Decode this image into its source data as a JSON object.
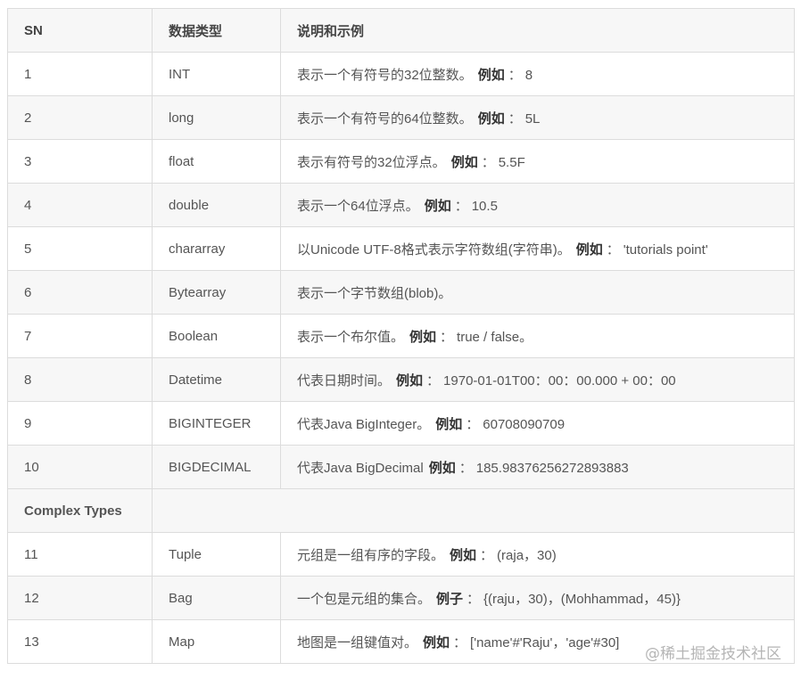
{
  "headers": [
    "SN",
    "数据类型",
    "说明和示例"
  ],
  "rows": [
    {
      "sn": "1",
      "type": "INT",
      "desc": "表示一个有符号的32位整数。",
      "ex_label": "例如",
      "ex_sep": "：",
      "ex_value": "8"
    },
    {
      "sn": "2",
      "type": "long",
      "desc": "表示一个有符号的64位整数。",
      "ex_label": "例如",
      "ex_sep": "：",
      "ex_value": "5L"
    },
    {
      "sn": "3",
      "type": "float",
      "desc": "表示有符号的32位浮点。",
      "ex_label": "例如",
      "ex_sep": "：",
      "ex_value": "5.5F"
    },
    {
      "sn": "4",
      "type": "double",
      "desc": "表示一个64位浮点。",
      "ex_label": "例如",
      "ex_sep": "：",
      "ex_value": "10.5"
    },
    {
      "sn": "5",
      "type": "chararray",
      "desc": "以Unicode UTF-8格式表示字符数组(字符串)。",
      "ex_label": "例如",
      "ex_sep": "：",
      "ex_value": "'tutorials point'"
    },
    {
      "sn": "6",
      "type": "Bytearray",
      "desc": "表示一个字节数组(blob)。",
      "ex_label": "",
      "ex_sep": "",
      "ex_value": ""
    },
    {
      "sn": "7",
      "type": "Boolean",
      "desc": "表示一个布尔值。",
      "ex_label": "例如",
      "ex_sep": "：",
      "ex_value": "true / false。"
    },
    {
      "sn": "8",
      "type": "Datetime",
      "desc": "代表日期时间。",
      "ex_label": "例如",
      "ex_sep": "：",
      "ex_value": "1970-01-01T00：00：00.000 + 00：00"
    },
    {
      "sn": "9",
      "type": "BIGINTEGER",
      "desc": "代表Java BigInteger。",
      "ex_label": "例如",
      "ex_sep": "：",
      "ex_value": "60708090709"
    },
    {
      "sn": "10",
      "type": "BIGDECIMAL",
      "desc": "代表Java BigDecimal",
      "ex_label": "例如",
      "ex_sep": "：",
      "ex_value": "185.98376256272893883"
    }
  ],
  "section_label": "Complex Types",
  "complex_rows": [
    {
      "sn": "11",
      "type": "Tuple",
      "desc": "元组是一组有序的字段。",
      "ex_label": "例如",
      "ex_sep": "：",
      "ex_value": "(raja，30)"
    },
    {
      "sn": "12",
      "type": "Bag",
      "desc": "一个包是元组的集合。",
      "ex_label": "例子",
      "ex_sep": "：",
      "ex_value": "{(raju，30)，(Mohhammad，45)}"
    },
    {
      "sn": "13",
      "type": "Map",
      "desc": "地图是一组键值对。",
      "ex_label": "例如",
      "ex_sep": "：",
      "ex_value": "['name'#'Raju'，'age'#30]"
    }
  ],
  "watermark": "@稀土掘金技术社区"
}
